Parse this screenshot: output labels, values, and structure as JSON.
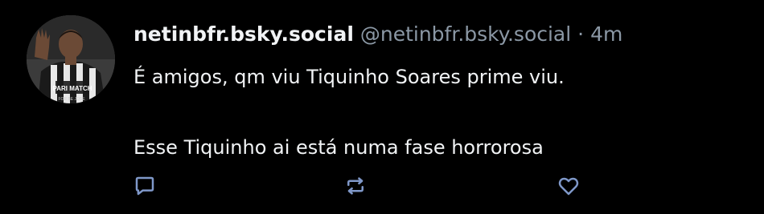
{
  "post": {
    "display_name": "netinbfr.bsky.social",
    "handle": "@netinbfr.bsky.social",
    "separator": "·",
    "time": "4m",
    "lines": [
      "É amigos, qm viu Tiquinho Soares prime viu.",
      "Esse Tiquinho ai está numa fase horrorosa"
    ]
  },
  "avatar": {
    "jersey_text": "PARI MATCH",
    "badge_text": "FOR BE JOSE"
  },
  "actions": [
    {
      "icon": "reply-icon"
    },
    {
      "icon": "repost-icon"
    },
    {
      "icon": "like-icon"
    }
  ],
  "colors": {
    "background": "#000000",
    "text": "#f1f3f5",
    "muted": "#8b98a5",
    "icon": "#7f98c9"
  }
}
